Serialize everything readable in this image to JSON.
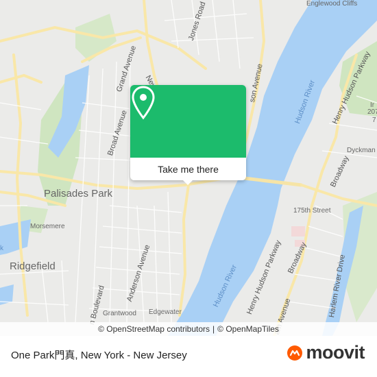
{
  "map": {
    "labels": {
      "englewood_cliffs": "Englewood Cliffs",
      "jones_road": "Jones Road",
      "grand_avenue": "Grand Avenue",
      "broad_avenue": "Broad Avenue",
      "hudson_river_top": "Hudson River",
      "henry_hudson_pkwy_top": "Henry Hudson Parkway",
      "dyckman_st": "Dyckman St",
      "broadway_top": "Broadway",
      "palisades_park": "Palisades Park",
      "morsemere": "Morsemere",
      "ridgefield": "Ridgefield",
      "street_175": "175th Street",
      "henry_hudson_pkwy_bottom": "Henry Hudson Parkway",
      "broadway_bottom": "Broadway",
      "harlem_river_drive": "Harlem River Drive",
      "anderson_avenue": "Anderson Avenue",
      "hudson_river_bottom": "Hudson River",
      "boulevard": "n Boulevard",
      "grantwood": "Grantwood",
      "edgewater": "Edgewater",
      "am_avenue": "am Avenue",
      "hudson_ave_partial": "son Avenue",
      "new_partial": "New",
      "ir_partial": "Ir",
      "num_207": "207",
      "num_7": "7",
      "k_partial": "k"
    }
  },
  "popup": {
    "action_label": "Take me there",
    "icon": "map-pin-icon",
    "accent_color": "#1cbb6c"
  },
  "attribution": {
    "osm": "© OpenStreetMap contributors",
    "separator": "|",
    "omt": "© OpenMapTiles"
  },
  "footer": {
    "title": "One Park門真, New York - New Jersey",
    "brand": "moovit",
    "brand_color": "#ff5a00"
  }
}
